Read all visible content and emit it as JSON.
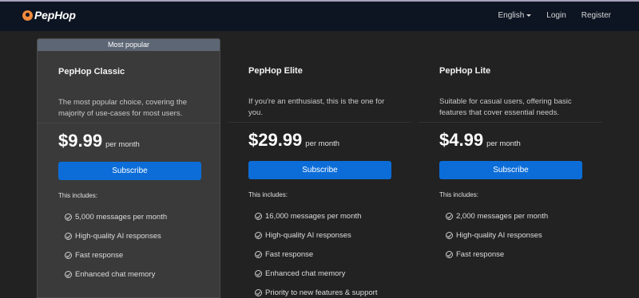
{
  "nav": {
    "brand": "PepHop",
    "language": "English",
    "login": "Login",
    "register": "Register"
  },
  "colors": {
    "navbar": "#0d1422",
    "page_bg": "#222222",
    "featured_card": "#3a3a3a",
    "ribbon": "#5c6674",
    "accent": "#0c6dd8",
    "logo": "#f08a3c"
  },
  "plans": [
    {
      "badge": "Most popular",
      "title": "PepHop Classic",
      "description": "The most popular choice, covering the majority of use-cases for most users.",
      "price": "$9.99",
      "period": "per month",
      "cta": "Subscribe",
      "includes_label": "This includes:",
      "features": [
        "5,000 messages per month",
        "High-quality AI responses",
        "Fast response",
        "Enhanced chat memory"
      ]
    },
    {
      "title": "PepHop Elite",
      "description": "If you're an enthusiast, this is the one for you.",
      "price": "$29.99",
      "period": "per month",
      "cta": "Subscribe",
      "includes_label": "This includes:",
      "features": [
        "16,000 messages per month",
        "High-quality AI responses",
        "Fast response",
        "Enhanced chat memory",
        "Priority to new features & support"
      ]
    },
    {
      "title": "PepHop Lite",
      "description": "Suitable for casual users, offering basic features that cover essential needs.",
      "price": "$4.99",
      "period": "per month",
      "cta": "Subscribe",
      "includes_label": "This includes:",
      "features": [
        "2,000 messages per month",
        "High-quality AI responses",
        "Fast response"
      ]
    }
  ]
}
